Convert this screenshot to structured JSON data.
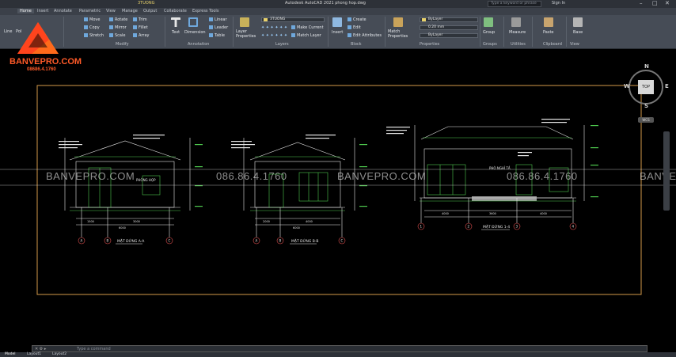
{
  "window": {
    "title": "Autodesk AutoCAD 2021   phong hop.dwg",
    "search_placeholder": "Type a keyword or phrase",
    "sign_in": "Sign In"
  },
  "tabs": [
    "Home",
    "Insert",
    "Annotate",
    "Parametric",
    "View",
    "Manage",
    "Output",
    "Collaborate",
    "Express Tools"
  ],
  "active_tab": "Home",
  "layer_tab_text": "3TUONG",
  "ribbon": {
    "draw": {
      "line": "Line",
      "polyline": "Pol"
    },
    "modify": {
      "title": "Modify",
      "move": "Move",
      "rotate": "Rotate",
      "trim": "Trim",
      "copy": "Copy",
      "mirror": "Mirror",
      "fillet": "Fillet",
      "stretch": "Stretch",
      "scale": "Scale",
      "array": "Array"
    },
    "annotation": {
      "title": "Annotation",
      "text": "Text",
      "dimension": "Dimension",
      "linear": "Linear",
      "leader": "Leader",
      "table": "Table"
    },
    "layers": {
      "title": "Layers",
      "layer_properties": "Layer Properties",
      "current_layer": "3TUONG",
      "make_current": "Make Current",
      "match_layer": "Match Layer"
    },
    "block": {
      "title": "Block",
      "insert": "Insert",
      "create": "Create",
      "edit": "Edit",
      "edit_attributes": "Edit Attributes"
    },
    "properties": {
      "title": "Properties",
      "match_properties": "Match Properties",
      "color": "ByLayer",
      "lineweight": "0.20 mm",
      "linetype": "ByLayer"
    },
    "groups": {
      "title": "Groups",
      "group": "Group"
    },
    "utilities": {
      "title": "Utilities",
      "measure": "Measure"
    },
    "clipboard": {
      "title": "Clipboard",
      "paste": "Paste"
    },
    "view": {
      "title": "View",
      "base": "Base"
    }
  },
  "logo": {
    "brand": "BANVEPRO.COM",
    "phone": "08686.4.1760"
  },
  "watermark": {
    "site": "BANVEPRO.COM",
    "phone": "086.86.4.1760"
  },
  "drawing": {
    "elev1_title": "MẶT ĐỨNG A-A",
    "elev2_title": "MẶT ĐỨNG B-B",
    "elev3_title": "MẶT ĐỨNG 1-4",
    "room_label_1": "PHÒNG HỌP",
    "room_label_3": "PHÒ NGHỈ TẦ",
    "axis_a": "A",
    "axis_b": "B",
    "axis_c": "C",
    "axis_1": "1",
    "axis_2": "2",
    "axis_3": "3",
    "axis_4": "4",
    "dim_1500": "1500",
    "dim_3000": "3000",
    "dim_2000": "2000",
    "dim_4000": "4000",
    "dim_3600": "3600",
    "dim_6000": "6000"
  },
  "viewcube": {
    "top": "TOP",
    "n": "N",
    "s": "S",
    "e": "E",
    "w": "W",
    "wcs": "WCS"
  },
  "command": {
    "placeholder": "Type a command"
  },
  "layout_tabs": [
    "Model",
    "Layout1",
    "Layout2"
  ],
  "colors": {
    "ribbon_bg": "#464c56",
    "canvas_bg": "#000000",
    "line_green": "#4ec94e",
    "line_white": "#e6e6e6",
    "border_orange": "#d49a4a"
  }
}
